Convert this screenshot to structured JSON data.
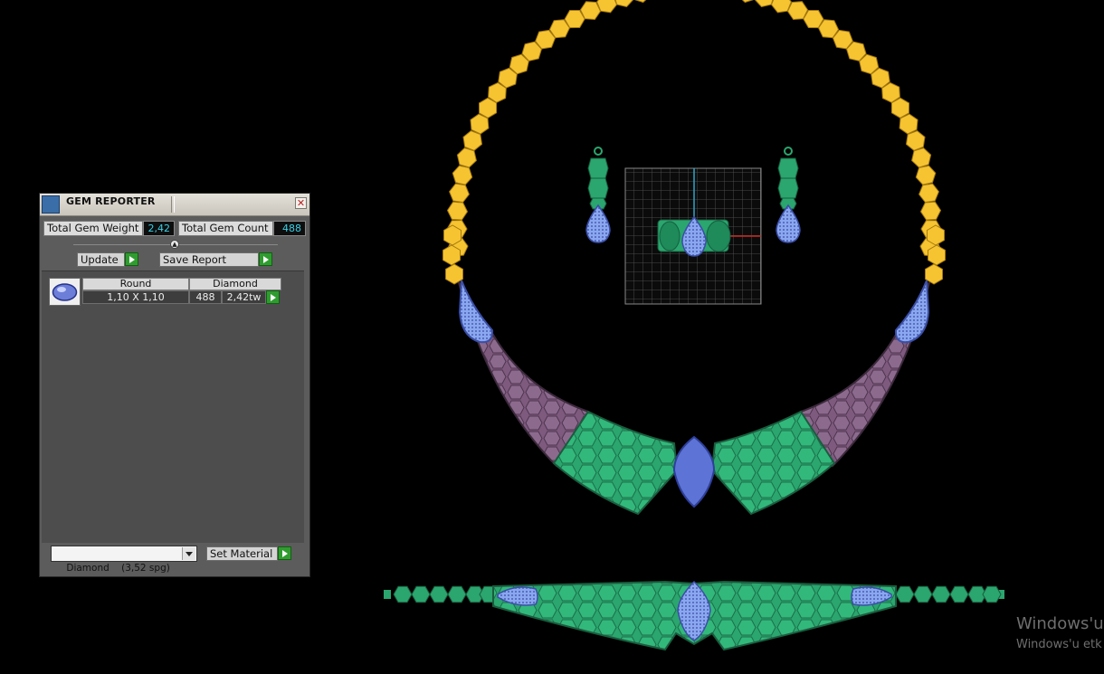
{
  "panel": {
    "title": "GEM REPORTER",
    "total_weight_label": "Total Gem Weight",
    "total_weight_value": "2,42",
    "total_count_label": "Total Gem Count",
    "total_count_value": "488",
    "update_label": "Update",
    "save_report_label": "Save Report",
    "table": {
      "columns": [
        "Round",
        "Diamond"
      ],
      "row": {
        "size": "1,10 X 1,10",
        "count": "488",
        "weight": "2,42tw"
      }
    },
    "material_select": "Diamond    (3,52 spg)",
    "set_material_label": "Set Material"
  },
  "watermark": {
    "line1": "Windows'u",
    "line2": "Windows'u etk"
  },
  "colors": {
    "gold": "#f7c431",
    "green": "#2aa66e",
    "purple": "#7d5a7e",
    "gem_blue": "#7f9ce8"
  }
}
